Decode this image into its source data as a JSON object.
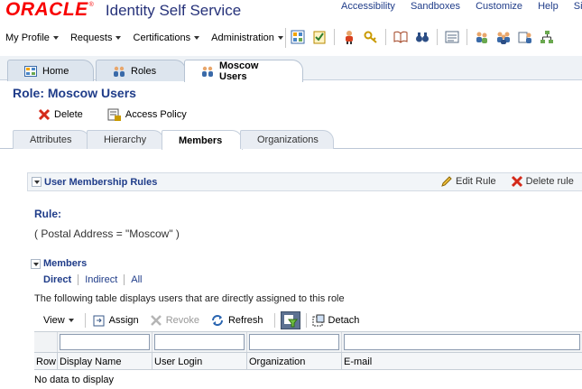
{
  "header": {
    "brand": "ORACLE",
    "app_title": "Identity Self Service",
    "links": [
      "Accessibility",
      "Sandboxes",
      "Customize",
      "Help",
      "Sign O"
    ]
  },
  "menubar": {
    "menus": [
      "My Profile",
      "Requests",
      "Certifications",
      "Administration"
    ],
    "toolbar_icons": [
      "dashboard-icon",
      "checklist-icon",
      "user-icon",
      "key-icon",
      "book-icon",
      "binoculars-icon",
      "form-icon",
      "user-group-icon",
      "users-icon",
      "org-users-icon",
      "org-tree-icon"
    ]
  },
  "tabs": [
    {
      "label": "Home",
      "icon": "home-grid-icon"
    },
    {
      "label": "Roles",
      "icon": "roles-icon"
    },
    {
      "label": "Moscow Users",
      "icon": "role-group-icon",
      "active": true
    }
  ],
  "page": {
    "title": "Role: Moscow Users",
    "actions": {
      "delete": "Delete",
      "access_policy": "Access Policy"
    }
  },
  "subtabs": [
    {
      "label": "Attributes"
    },
    {
      "label": "Hierarchy"
    },
    {
      "label": "Members",
      "active": true
    },
    {
      "label": "Organizations"
    }
  ],
  "membership_rules": {
    "title": "User Membership Rules",
    "edit_rule": "Edit Rule",
    "delete_rule": "Delete rule",
    "rule_label": "Rule:",
    "rule_value": "( Postal Address = \"Moscow\" )"
  },
  "members": {
    "title": "Members",
    "views": {
      "direct": "Direct",
      "indirect": "Indirect",
      "all": "All"
    },
    "description": "The following table displays users that are directly assigned to this role",
    "toolbar": {
      "view": "View",
      "assign": "Assign",
      "revoke": "Revoke",
      "refresh": "Refresh",
      "detach": "Detach"
    },
    "columns": [
      "Row",
      "Display Name",
      "User Login",
      "Organization",
      "E-mail"
    ],
    "empty_text": "No data to display"
  }
}
